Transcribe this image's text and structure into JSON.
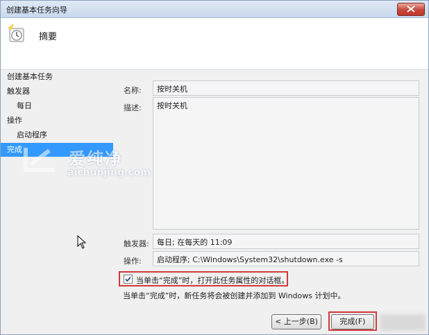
{
  "window": {
    "title": "创建基本任务向导"
  },
  "header": {
    "title": "摘要"
  },
  "steps": [
    {
      "label": "创建基本任务"
    },
    {
      "label": "触发器"
    },
    {
      "label": "每日"
    },
    {
      "label": "操作"
    },
    {
      "label": "启动程序"
    },
    {
      "label": "完成"
    }
  ],
  "form": {
    "name_label": "名称:",
    "name_value": "按时关机",
    "desc_label": "描述:",
    "desc_value": "按时关机",
    "trigger_label": "触发器:",
    "trigger_value": "每日; 在每天的 11:09",
    "action_label": "操作:",
    "action_value": "启动程序; C:\\Windows\\System32\\shutdown.exe -s"
  },
  "checkbox": {
    "label": "当单击“完成”时，打开此任务属性的对话框。",
    "checked": true
  },
  "info_text": "当单击“完成”时，新任务将会被创建并添加到 Windows 计划中。",
  "buttons": {
    "back": "< 上一步(B)",
    "finish": "完成(F)"
  },
  "watermark": {
    "text": "爱纯净",
    "sub": "aichunjing.com"
  },
  "colors": {
    "active_step": "#3399ff",
    "highlight": "#d23838"
  }
}
